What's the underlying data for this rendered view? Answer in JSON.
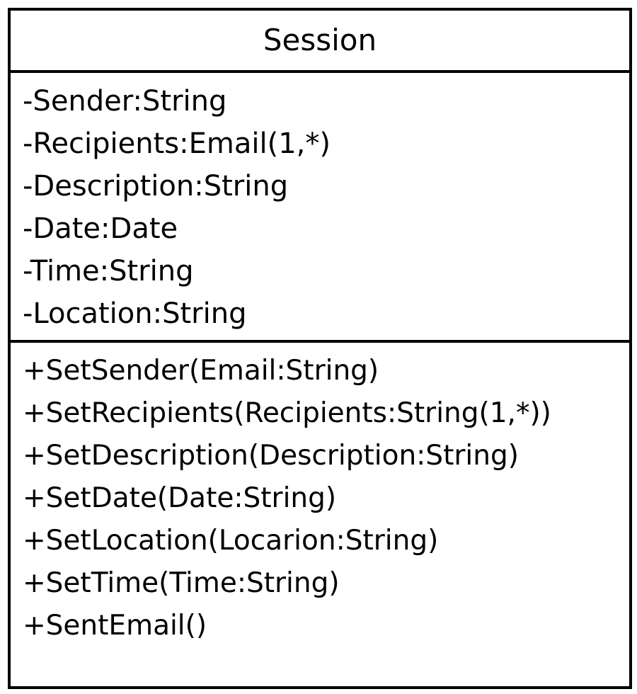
{
  "class_name": "Session",
  "attributes": [
    "-Sender:String",
    "-Recipients:Email(1,*)",
    "-Description:String",
    "-Date:Date",
    "-Time:String",
    "-Location:String"
  ],
  "operations": [
    "+SetSender(Email:String)",
    "+SetRecipients(Recipients:String(1,*))",
    "+SetDescription(Description:String)",
    "+SetDate(Date:String)",
    "+SetLocation(Locarion:String)",
    "+SetTime(Time:String)",
    "+SentEmail()"
  ],
  "colors": {
    "border": "#000000",
    "background": "#ffffff",
    "text": "#000000"
  }
}
